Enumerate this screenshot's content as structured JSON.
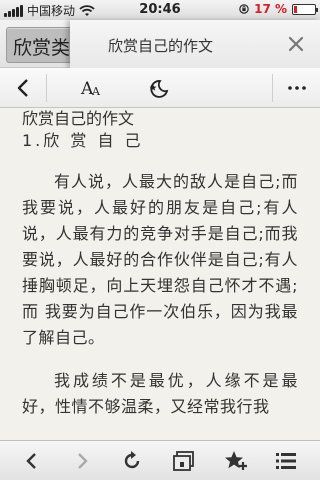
{
  "status": {
    "carrier": "中国移动",
    "time": "20:46",
    "battery_percent": "17 %",
    "battery_level": 0.17
  },
  "titlebar": {
    "background_tab_label": "欣赏类",
    "page_title": "欣赏自己的作文"
  },
  "toolbar": {
    "back": "back-icon",
    "font": "font-size-icon",
    "night": "night-mode-icon",
    "more": "more-icon"
  },
  "article": {
    "title": "欣赏自己的作文",
    "subtitle": "1.欣 赏 自 己",
    "paragraphs": [
      "有人说，人最大的敌人是自己;而我要说，人最好的朋友是自己;有人说，人最有力的竞争对手是自己;而我要说，人最好的合作伙伴是自己;有人捶胸顿足，向上天埋怨自己怀才不遇;而 我要为自己作一次伯乐，因为我最了解自己。",
      "我成绩不是最优，人缘不是最好，性情不够温柔，又经常我行我"
    ]
  },
  "bottombar": {
    "items": [
      "back-arrow-icon",
      "forward-arrow-icon",
      "refresh-icon",
      "tabs-icon",
      "bookmark-add-icon",
      "menu-icon"
    ]
  },
  "colors": {
    "battery_text": "#d0202a",
    "content_bg": "#f3f1ec",
    "text": "#333333"
  }
}
